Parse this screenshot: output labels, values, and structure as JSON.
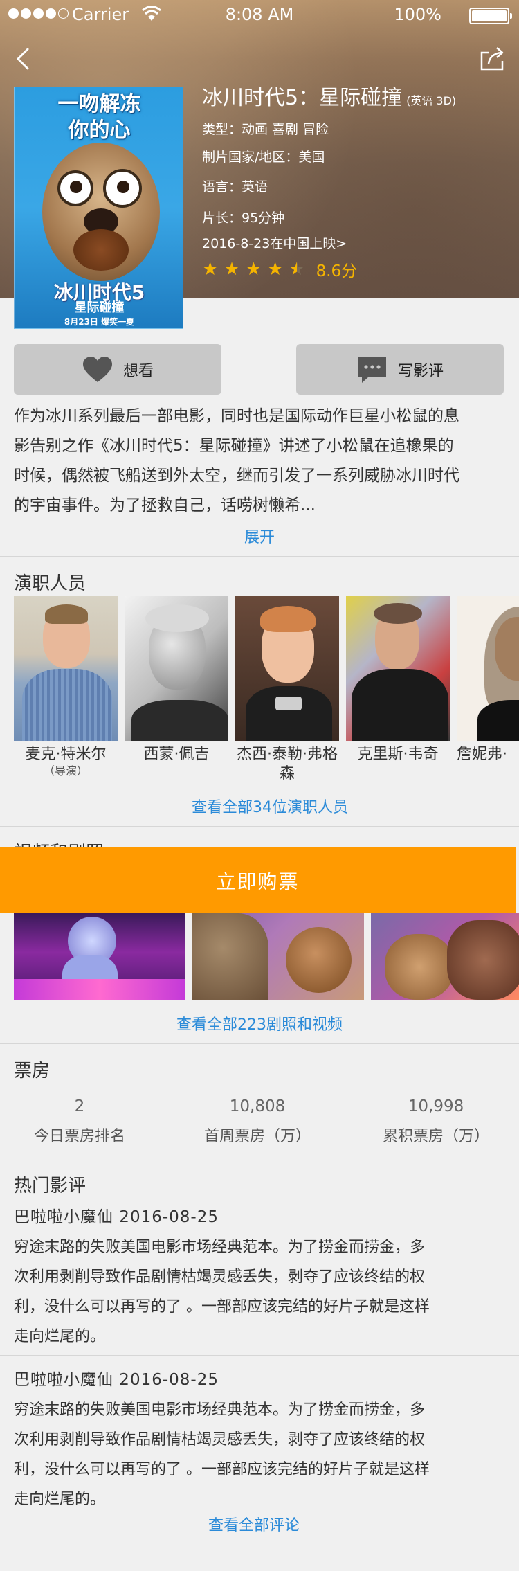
{
  "status_bar": {
    "carrier": "Carrier",
    "time": "8:08 AM",
    "battery": "100%"
  },
  "movie": {
    "title": "冰川时代5：星际碰撞",
    "format": "(英语 3D)",
    "genre": "类型：动画 喜剧 冒险",
    "country": "制片国家/地区：美国",
    "language": "语言：英语",
    "runtime": "片长：95分钟",
    "release": "2016-8-23在中国上映>",
    "rating": 4.5,
    "score": "8.6分",
    "poster": {
      "tagline_line1": "一吻解冻",
      "tagline_line2": "你的心",
      "name": "冰川时代5",
      "subtitle": "星际碰撞",
      "date": "8月23日 爆笑一夏"
    }
  },
  "actions": {
    "want": "想看",
    "review": "写影评"
  },
  "description": {
    "lines": [
      "作为冰川系列最后一部电影，同时也是国际动作巨星小松鼠的息",
      "影告别之作《冰川时代5：星际碰撞》讲述了小松鼠在追橡果的",
      "时候，偶然被飞船送到外太空，继而引发了一系列威胁冰川时代",
      "的宇宙事件。为了拯救自己，话唠树懒希..."
    ],
    "expand": "展开"
  },
  "cast": {
    "title": "演职人员",
    "members": [
      {
        "name": "麦克·特米尔",
        "role": "（导演）"
      },
      {
        "name": "西蒙·佩吉",
        "role": ""
      },
      {
        "name": "杰西·泰勒·弗格森",
        "role": ""
      },
      {
        "name": "克里斯·韦奇",
        "role": ""
      },
      {
        "name": "詹妮弗·",
        "role": ""
      }
    ],
    "view_all": "查看全部34位演职人员"
  },
  "media": {
    "title": "视频和剧照",
    "view_all": "查看全部223剧照和视频"
  },
  "buy": {
    "label": "立即购票"
  },
  "box_office": {
    "title": "票房",
    "stats": [
      {
        "value": "2",
        "label": "今日票房排名"
      },
      {
        "value": "10,808",
        "label": "首周票房（万）"
      },
      {
        "value": "10,998",
        "label": "累积票房（万）"
      }
    ]
  },
  "reviews": {
    "title": "热门影评",
    "items": [
      {
        "author_date": "巴啦啦小魔仙  2016-08-25",
        "lines": [
          "穷途末路的失败美国电影市场经典范本。为了捞金而捞金，多",
          "次利用剥削导致作品剧情枯竭灵感丢失，剥夺了应该终结的权",
          "利，没什么可以再写的了 。一部部应该完结的好片子就是这样",
          "走向烂尾的。"
        ]
      },
      {
        "author_date": "巴啦啦小魔仙  2016-08-25",
        "lines": [
          "穷途末路的失败美国电影市场经典范本。为了捞金而捞金，多",
          "次利用剥削导致作品剧情枯竭灵感丢失，剥夺了应该终结的权",
          "利，没什么可以再写的了 。一部部应该完结的好片子就是这样",
          "走向烂尾的。"
        ]
      }
    ],
    "view_all": "查看全部评论"
  },
  "colors": {
    "accent": "#ff9a00",
    "link": "#2a8ad8",
    "star": "#f5b400"
  }
}
